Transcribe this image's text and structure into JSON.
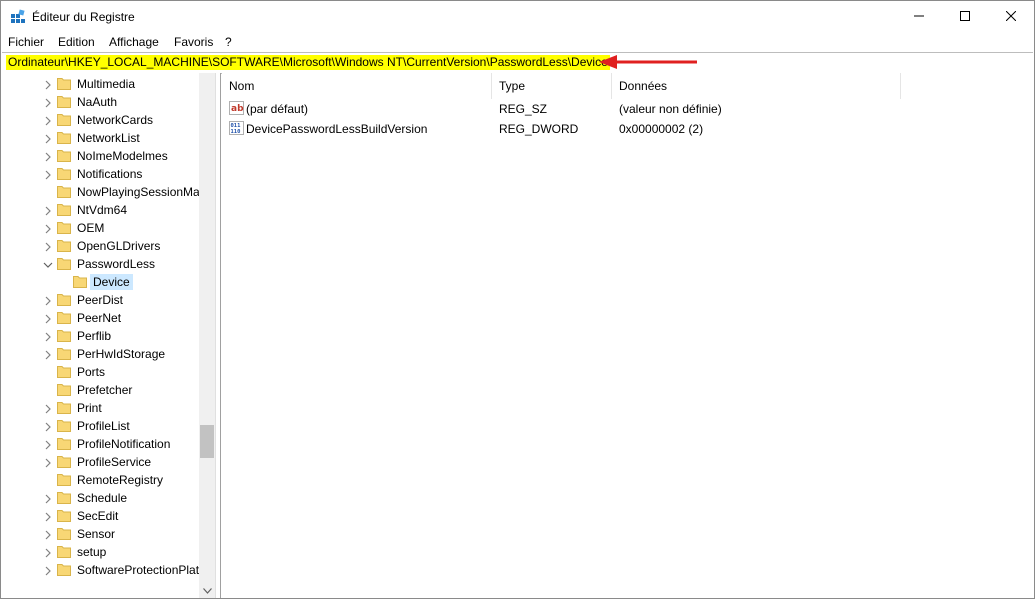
{
  "window": {
    "title": "Éditeur du Registre",
    "app_icon": "registry-editor-icon",
    "controls": {
      "minimize": "minimize-icon",
      "maximize": "maximize-icon",
      "close": "close-icon"
    }
  },
  "menu": {
    "items": [
      {
        "label": "Fichier"
      },
      {
        "label": "Edition"
      },
      {
        "label": "Affichage"
      },
      {
        "label": "Favoris"
      },
      {
        "label": "?"
      }
    ]
  },
  "address": {
    "path": "Ordinateur\\HKEY_LOCAL_MACHINE\\SOFTWARE\\Microsoft\\Windows NT\\CurrentVersion\\PasswordLess\\Device",
    "highlight_color": "#ffff00",
    "annotation": "red-arrow-icon"
  },
  "tree": {
    "items": [
      {
        "label": "Multimedia",
        "chevron": "collapsed"
      },
      {
        "label": "NaAuth",
        "chevron": "collapsed"
      },
      {
        "label": "NetworkCards",
        "chevron": "collapsed"
      },
      {
        "label": "NetworkList",
        "chevron": "collapsed"
      },
      {
        "label": "NoImeModelmes",
        "chevron": "collapsed"
      },
      {
        "label": "Notifications",
        "chevron": "collapsed"
      },
      {
        "label": "NowPlayingSessionMar",
        "chevron": "none"
      },
      {
        "label": "NtVdm64",
        "chevron": "collapsed"
      },
      {
        "label": "OEM",
        "chevron": "collapsed"
      },
      {
        "label": "OpenGLDrivers",
        "chevron": "collapsed"
      },
      {
        "label": "PasswordLess",
        "chevron": "expanded"
      },
      {
        "label": "Device",
        "chevron": "none",
        "child": true,
        "selected": true
      },
      {
        "label": "PeerDist",
        "chevron": "collapsed"
      },
      {
        "label": "PeerNet",
        "chevron": "collapsed"
      },
      {
        "label": "Perflib",
        "chevron": "collapsed"
      },
      {
        "label": "PerHwIdStorage",
        "chevron": "collapsed"
      },
      {
        "label": "Ports",
        "chevron": "none"
      },
      {
        "label": "Prefetcher",
        "chevron": "none"
      },
      {
        "label": "Print",
        "chevron": "collapsed"
      },
      {
        "label": "ProfileList",
        "chevron": "collapsed"
      },
      {
        "label": "ProfileNotification",
        "chevron": "collapsed"
      },
      {
        "label": "ProfileService",
        "chevron": "collapsed"
      },
      {
        "label": "RemoteRegistry",
        "chevron": "none"
      },
      {
        "label": "Schedule",
        "chevron": "collapsed"
      },
      {
        "label": "SecEdit",
        "chevron": "collapsed"
      },
      {
        "label": "Sensor",
        "chevron": "collapsed"
      },
      {
        "label": "setup",
        "chevron": "collapsed"
      },
      {
        "label": "SoftwareProtectionPlat",
        "chevron": "collapsed"
      }
    ],
    "selection_color": "#cce8ff",
    "folder_color": "#f8d775"
  },
  "list": {
    "columns": {
      "name": "Nom",
      "type": "Type",
      "data": "Données"
    },
    "rows": [
      {
        "icon": "string-value-icon",
        "name": "(par défaut)",
        "type": "REG_SZ",
        "data": "(valeur non définie)"
      },
      {
        "icon": "binary-value-icon",
        "name": "DevicePasswordLessBuildVersion",
        "type": "REG_DWORD",
        "data": "0x00000002 (2)"
      }
    ]
  }
}
